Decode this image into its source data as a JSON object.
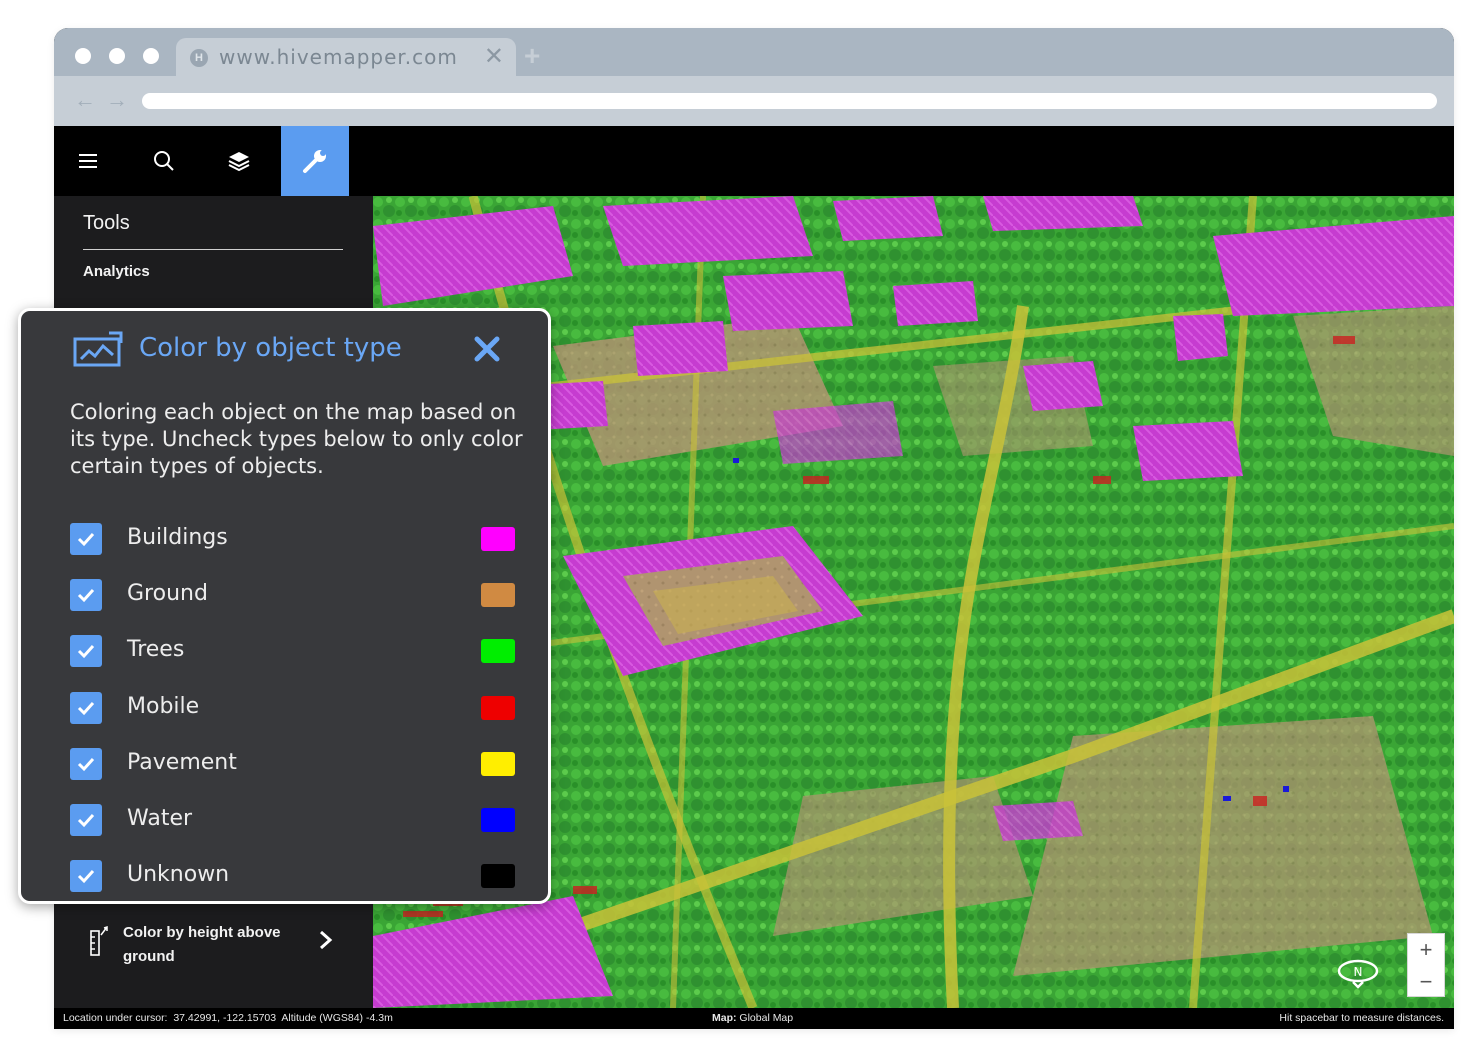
{
  "browser": {
    "url": "www.hivemapper.com",
    "favicon": "H"
  },
  "toolbar": {
    "buttons": [
      "menu-icon",
      "search-icon",
      "layers-icon",
      "wrench-icon"
    ],
    "active_color": "#5b9cf0"
  },
  "sidebar": {
    "title": "Tools",
    "analytics_label": "Analytics",
    "height_item_label": "Color by height above ground"
  },
  "panel": {
    "title": "Color by object type",
    "description": "Coloring each object on the map based on its type. Uncheck types below to only color certain types of objects.",
    "types": [
      {
        "label": "Buildings",
        "checked": true,
        "color": "#ff00ff"
      },
      {
        "label": "Ground",
        "checked": true,
        "color": "#d08a42"
      },
      {
        "label": "Trees",
        "checked": true,
        "color": "#00ee00"
      },
      {
        "label": "Mobile",
        "checked": true,
        "color": "#ee0000"
      },
      {
        "label": "Pavement",
        "checked": true,
        "color": "#ffee00"
      },
      {
        "label": "Water",
        "checked": true,
        "color": "#0000ff"
      },
      {
        "label": "Unknown",
        "checked": true,
        "color": "#000000"
      }
    ]
  },
  "map": {
    "zoom_in": "+",
    "zoom_out": "−",
    "compass_label": "N"
  },
  "status": {
    "location_label": "Location under cursor:",
    "location_value": "37.42991, -122.15703",
    "altitude_label": "Altitude (WGS84)",
    "altitude_value": "-4.3m",
    "map_label": "Map:",
    "map_value": "Global Map",
    "hint": "Hit spacebar to measure distances."
  }
}
